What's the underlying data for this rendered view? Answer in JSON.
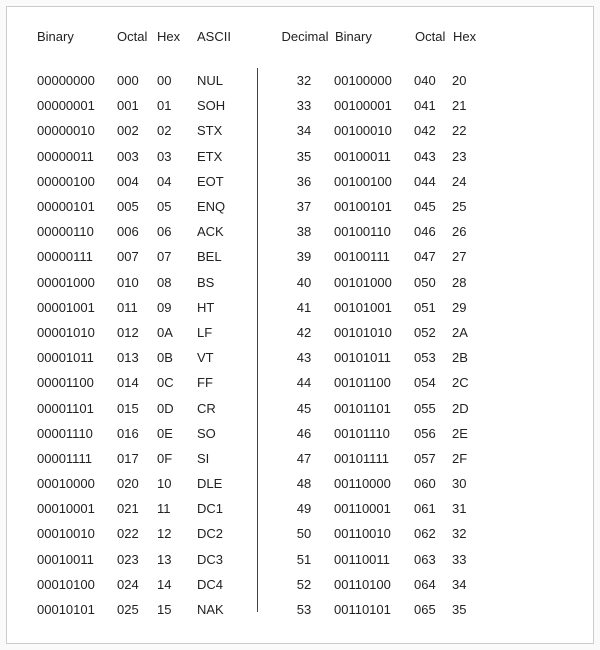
{
  "headers": {
    "left": {
      "binary": "Binary",
      "octal": "Octal",
      "hex": "Hex",
      "ascii": "ASCII"
    },
    "right": {
      "decimal": "Decimal",
      "binary": "Binary",
      "octal": "Octal",
      "hex": "Hex"
    }
  },
  "leftRows": [
    {
      "binary": "00000000",
      "octal": "000",
      "hex": "00",
      "ascii": "NUL"
    },
    {
      "binary": "00000001",
      "octal": "001",
      "hex": "01",
      "ascii": "SOH"
    },
    {
      "binary": "00000010",
      "octal": "002",
      "hex": "02",
      "ascii": "STX"
    },
    {
      "binary": "00000011",
      "octal": "003",
      "hex": "03",
      "ascii": "ETX"
    },
    {
      "binary": "00000100",
      "octal": "004",
      "hex": "04",
      "ascii": "EOT"
    },
    {
      "binary": "00000101",
      "octal": "005",
      "hex": "05",
      "ascii": "ENQ"
    },
    {
      "binary": "00000110",
      "octal": "006",
      "hex": "06",
      "ascii": "ACK"
    },
    {
      "binary": "00000111",
      "octal": "007",
      "hex": "07",
      "ascii": "BEL"
    },
    {
      "binary": "00001000",
      "octal": "010",
      "hex": "08",
      "ascii": "BS"
    },
    {
      "binary": "00001001",
      "octal": "011",
      "hex": "09",
      "ascii": "HT"
    },
    {
      "binary": "00001010",
      "octal": "012",
      "hex": "0A",
      "ascii": "LF"
    },
    {
      "binary": "00001011",
      "octal": "013",
      "hex": "0B",
      "ascii": "VT"
    },
    {
      "binary": "00001100",
      "octal": "014",
      "hex": "0C",
      "ascii": "FF"
    },
    {
      "binary": "00001101",
      "octal": "015",
      "hex": "0D",
      "ascii": "CR"
    },
    {
      "binary": "00001110",
      "octal": "016",
      "hex": "0E",
      "ascii": "SO"
    },
    {
      "binary": "00001111",
      "octal": "017",
      "hex": "0F",
      "ascii": "SI"
    },
    {
      "binary": "00010000",
      "octal": "020",
      "hex": "10",
      "ascii": "DLE"
    },
    {
      "binary": "00010001",
      "octal": "021",
      "hex": "11",
      "ascii": "DC1"
    },
    {
      "binary": "00010010",
      "octal": "022",
      "hex": "12",
      "ascii": "DC2"
    },
    {
      "binary": "00010011",
      "octal": "023",
      "hex": "13",
      "ascii": "DC3"
    },
    {
      "binary": "00010100",
      "octal": "024",
      "hex": "14",
      "ascii": "DC4"
    },
    {
      "binary": "00010101",
      "octal": "025",
      "hex": "15",
      "ascii": "NAK"
    }
  ],
  "rightRows": [
    {
      "decimal": "32",
      "binary": "00100000",
      "octal": "040",
      "hex": "20"
    },
    {
      "decimal": "33",
      "binary": "00100001",
      "octal": "041",
      "hex": "21"
    },
    {
      "decimal": "34",
      "binary": "00100010",
      "octal": "042",
      "hex": "22"
    },
    {
      "decimal": "35",
      "binary": "00100011",
      "octal": "043",
      "hex": "23"
    },
    {
      "decimal": "36",
      "binary": "00100100",
      "octal": "044",
      "hex": "24"
    },
    {
      "decimal": "37",
      "binary": "00100101",
      "octal": "045",
      "hex": "25"
    },
    {
      "decimal": "38",
      "binary": "00100110",
      "octal": "046",
      "hex": "26"
    },
    {
      "decimal": "39",
      "binary": "00100111",
      "octal": "047",
      "hex": "27"
    },
    {
      "decimal": "40",
      "binary": "00101000",
      "octal": "050",
      "hex": "28"
    },
    {
      "decimal": "41",
      "binary": "00101001",
      "octal": "051",
      "hex": "29"
    },
    {
      "decimal": "42",
      "binary": "00101010",
      "octal": "052",
      "hex": "2A"
    },
    {
      "decimal": "43",
      "binary": "00101011",
      "octal": "053",
      "hex": "2B"
    },
    {
      "decimal": "44",
      "binary": "00101100",
      "octal": "054",
      "hex": "2C"
    },
    {
      "decimal": "45",
      "binary": "00101101",
      "octal": "055",
      "hex": "2D"
    },
    {
      "decimal": "46",
      "binary": "00101110",
      "octal": "056",
      "hex": "2E"
    },
    {
      "decimal": "47",
      "binary": "00101111",
      "octal": "057",
      "hex": "2F"
    },
    {
      "decimal": "48",
      "binary": "00110000",
      "octal": "060",
      "hex": "30"
    },
    {
      "decimal": "49",
      "binary": "00110001",
      "octal": "061",
      "hex": "31"
    },
    {
      "decimal": "50",
      "binary": "00110010",
      "octal": "062",
      "hex": "32"
    },
    {
      "decimal": "51",
      "binary": "00110011",
      "octal": "063",
      "hex": "33"
    },
    {
      "decimal": "52",
      "binary": "00110100",
      "octal": "064",
      "hex": "34"
    },
    {
      "decimal": "53",
      "binary": "00110101",
      "octal": "065",
      "hex": "35"
    }
  ]
}
